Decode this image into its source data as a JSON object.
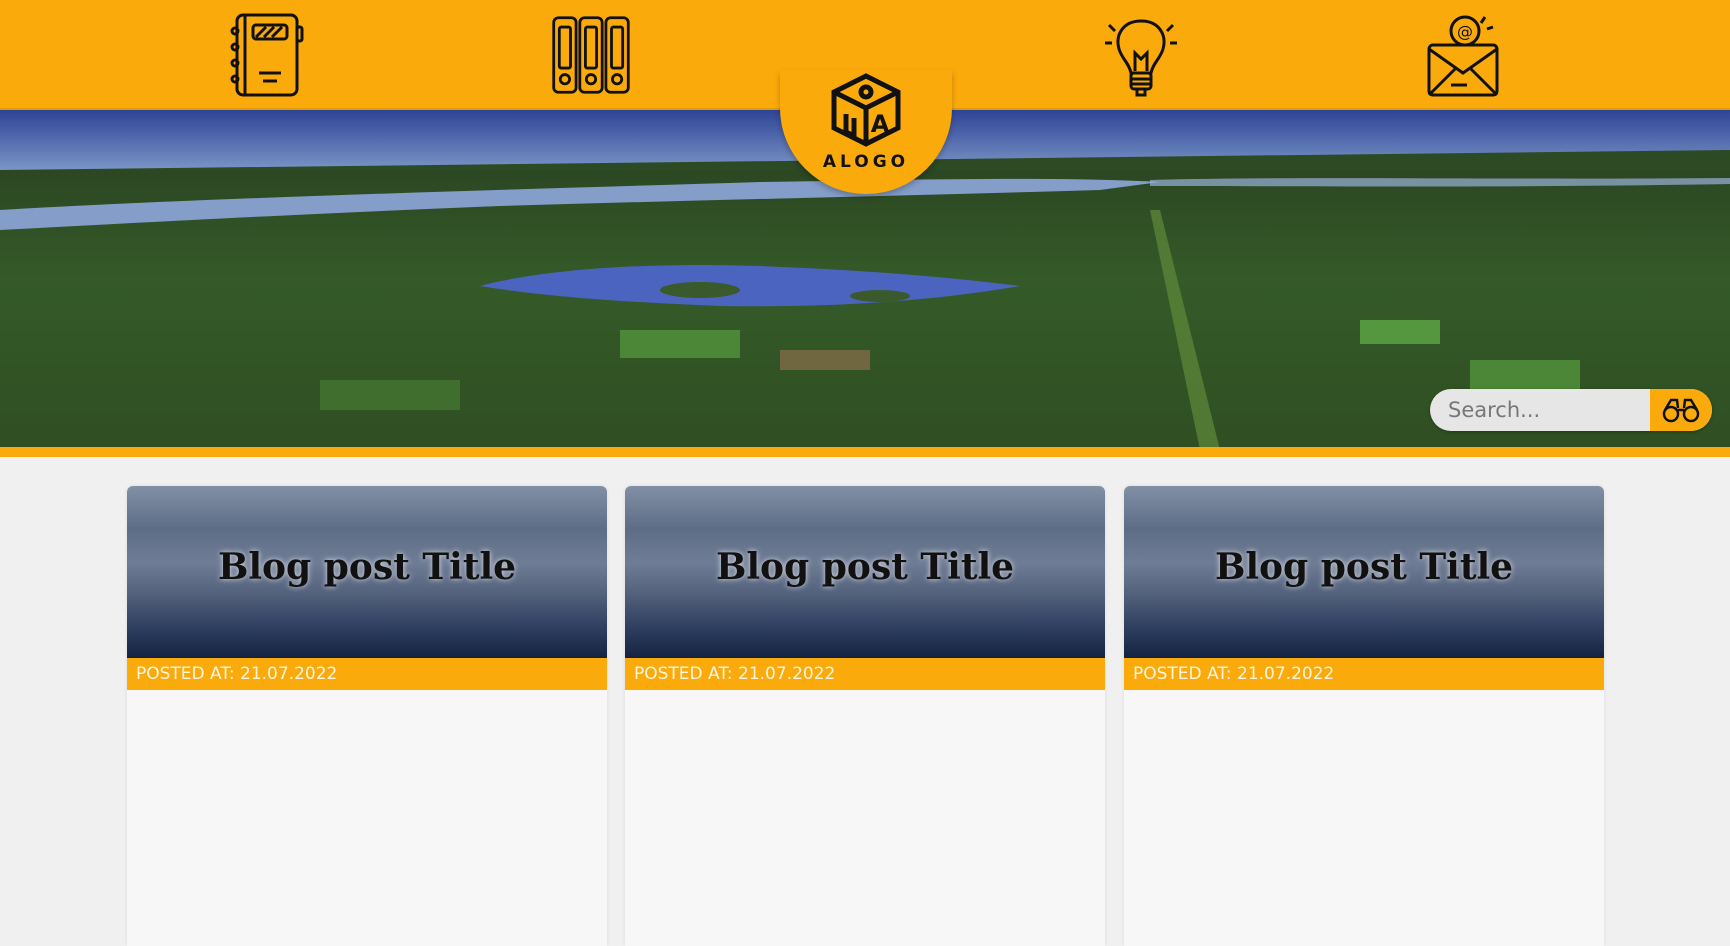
{
  "nav": {
    "icons": [
      "notebook-icon",
      "binders-icon",
      "lightbulb-icon",
      "email-icon"
    ]
  },
  "logo": {
    "text": "ALOGO",
    "icon": "cube-logo-icon"
  },
  "search": {
    "placeholder": "Search...",
    "icon": "binoculars-icon"
  },
  "posts": [
    {
      "title": "Blog post Title",
      "meta": "POSTED AT: 21.07.2022"
    },
    {
      "title": "Blog post Title",
      "meta": "POSTED AT: 21.07.2022"
    },
    {
      "title": "Blog post Title",
      "meta": "POSTED AT: 21.07.2022"
    }
  ],
  "colors": {
    "accent": "#fbaa0c",
    "background": "#f0f0f0"
  }
}
